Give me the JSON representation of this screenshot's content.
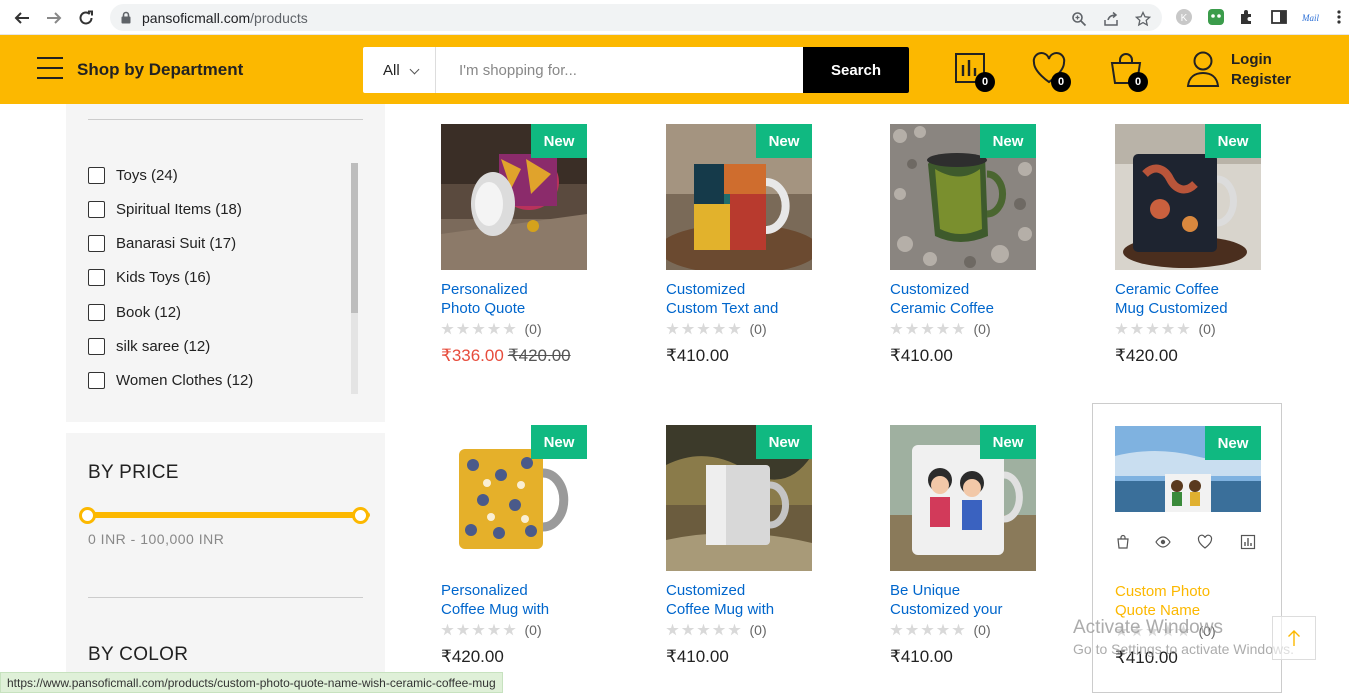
{
  "browser": {
    "url_host": "pansoficmall.com",
    "url_path": "/products"
  },
  "header": {
    "department_label": "Shop by Department",
    "search_category": "All",
    "search_placeholder": "I'm shopping for...",
    "search_button": "Search",
    "compare_count": "0",
    "wishlist_count": "0",
    "cart_count": "0",
    "login_label": "Login",
    "register_label": "Register",
    "accent_color": "#fcb800"
  },
  "sidebar": {
    "categories": [
      {
        "label": "Toys (24)"
      },
      {
        "label": "Spiritual Items (18)"
      },
      {
        "label": "Banarasi Suit (17)"
      },
      {
        "label": "Kids Toys (16)"
      },
      {
        "label": "Book (12)"
      },
      {
        "label": "silk saree (12)"
      },
      {
        "label": "Women Clothes (12)"
      }
    ],
    "price_title": "BY PRICE",
    "price_range_text": "0 INR - 100,000 INR",
    "color_title": "BY COLOR"
  },
  "products": [
    {
      "badge": "New",
      "name_line1": "Personalized",
      "name_line2": "Photo Quote",
      "rating_count": "(0)",
      "sale_price": "₹336.00",
      "old_price": "₹420.00"
    },
    {
      "badge": "New",
      "name_line1": "Customized",
      "name_line2": "Custom Text and",
      "rating_count": "(0)",
      "price": "₹410.00"
    },
    {
      "badge": "New",
      "name_line1": "Customized",
      "name_line2": "Ceramic Coffee",
      "rating_count": "(0)",
      "price": "₹410.00"
    },
    {
      "badge": "New",
      "name_line1": "Ceramic Coffee",
      "name_line2": "Mug Customized",
      "rating_count": "(0)",
      "price": "₹420.00"
    },
    {
      "badge": "New",
      "name_line1": "Personalized",
      "name_line2": "Coffee Mug with",
      "rating_count": "(0)",
      "price": "₹420.00"
    },
    {
      "badge": "New",
      "name_line1": "Customized",
      "name_line2": "Coffee Mug with",
      "rating_count": "(0)",
      "price": "₹410.00"
    },
    {
      "badge": "New",
      "name_line1": "Be Unique",
      "name_line2": "Customized your",
      "rating_count": "(0)",
      "price": "₹410.00"
    },
    {
      "badge": "New",
      "name_line1": "Custom Photo",
      "name_line2": "Quote Name",
      "rating_count": "(0)",
      "price": "₹410.00"
    }
  ],
  "status_bar": "https://www.pansoficmall.com/products/custom-photo-quote-name-wish-ceramic-coffee-mug",
  "watermark": {
    "line1": "Activate Windows",
    "line2": "Go to Settings to activate Windows."
  }
}
